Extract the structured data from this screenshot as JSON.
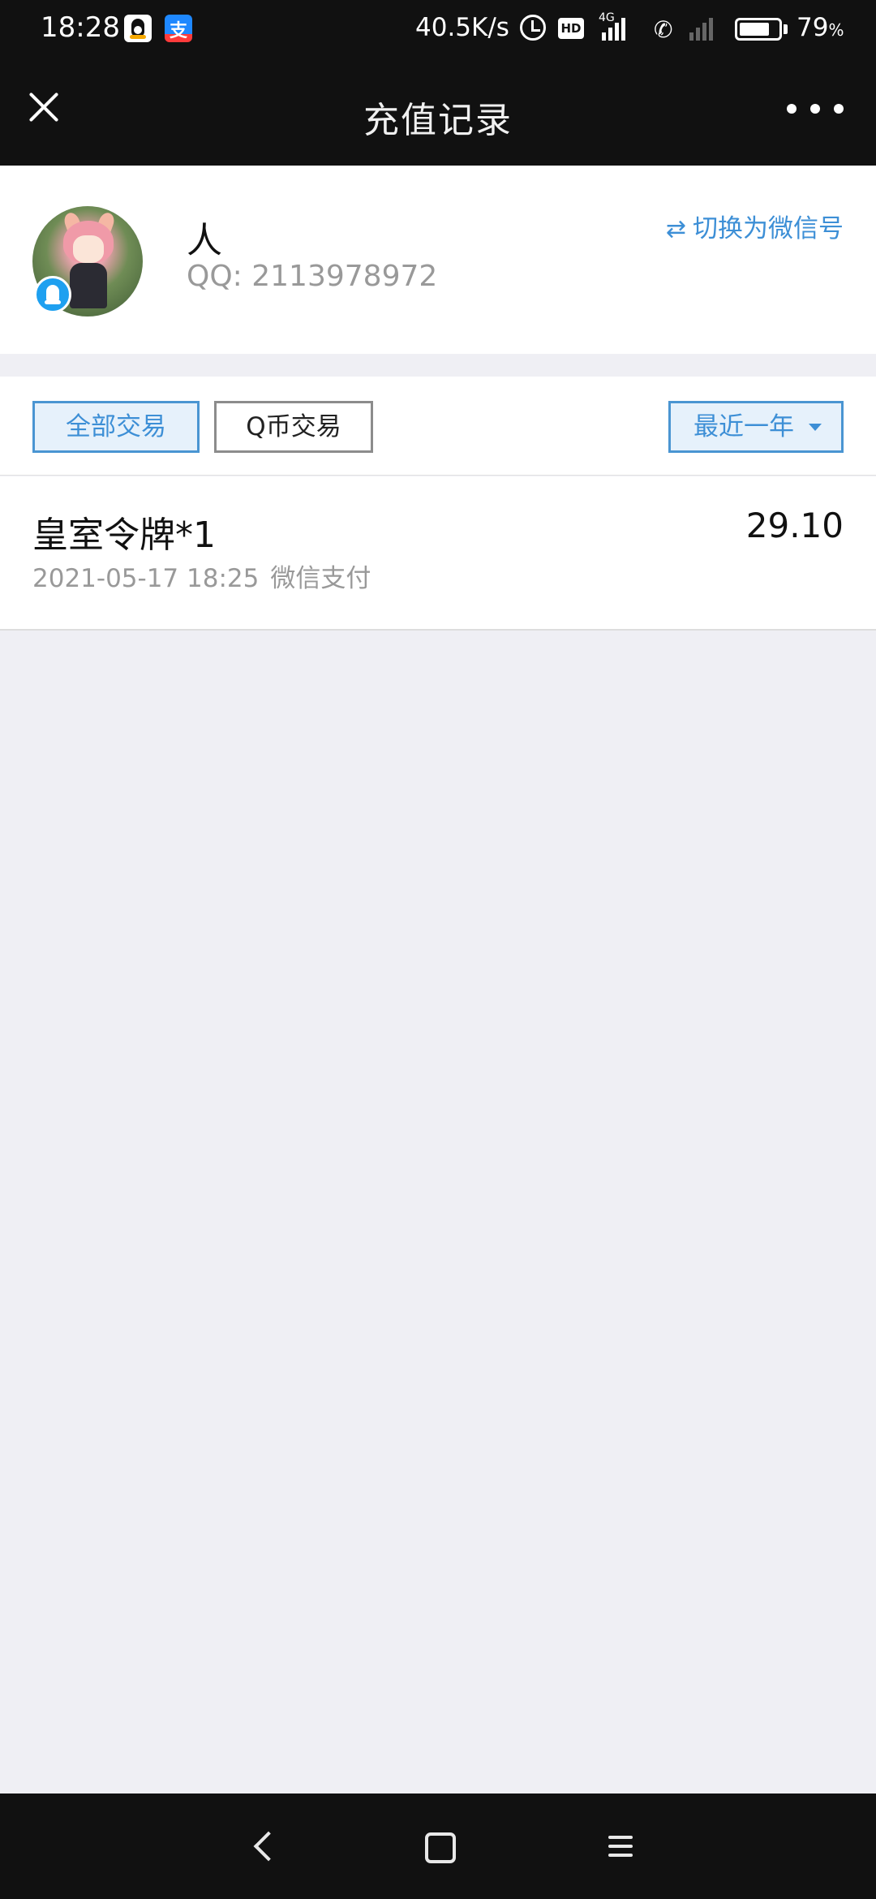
{
  "status_bar": {
    "time": "18:28",
    "network_speed": "40.5K/s",
    "signal_label": "4G",
    "hd_label": "HD",
    "battery_percent": "79",
    "battery_unit": "%",
    "battery_level": 0.79,
    "notification_icons": [
      "qq-icon",
      "alipay-icon"
    ],
    "alipay_glyph": "支"
  },
  "header": {
    "title": "充值记录"
  },
  "profile": {
    "name": "人",
    "qq_label": "QQ: 2113978972",
    "switch_label": "切换为微信号",
    "switch_glyph": "⇄"
  },
  "filters": {
    "all_label": "全部交易",
    "qcoin_label": "Q币交易",
    "range_label": "最近一年"
  },
  "records": [
    {
      "title": "皇室令牌*1",
      "amount": "29.10",
      "datetime": "2021-05-17 18:25",
      "method": "微信支付"
    }
  ],
  "colors": {
    "bar_bg": "#111111",
    "page_bg": "#efeff4",
    "accent": "#3d8fd6",
    "accent_bg": "#e6f1fb",
    "muted_text": "#999999"
  }
}
